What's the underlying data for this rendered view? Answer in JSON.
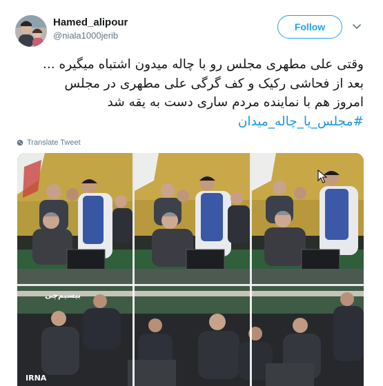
{
  "tweet": {
    "display_name": "Hamed_alipour",
    "handle": "@niala1000jerib",
    "follow_label": "Follow",
    "body_lines": [
      "وقتی علی مطهری مجلس رو با چاله میدون اشتباه میگیره ...",
      "بعد از فحاشی رکیک و کف گرگی علی مطهری در مجلس",
      "امروز هم با نماینده مردم ساری دست به یقه شد"
    ],
    "hashtag": "#مجلس_یا_چاله_میدان",
    "translate_label": "Translate Tweet"
  },
  "media": {
    "watermark_top": "بیسیم‌چی",
    "watermark_bottom": "IRNA"
  },
  "colors": {
    "accent": "#1da1f2",
    "hashtag": "#1b95e0",
    "secondary_text": "#657786",
    "primary_text": "#14171a"
  },
  "icons": {
    "more": "chevron-down-icon",
    "translate": "globe-icon"
  }
}
